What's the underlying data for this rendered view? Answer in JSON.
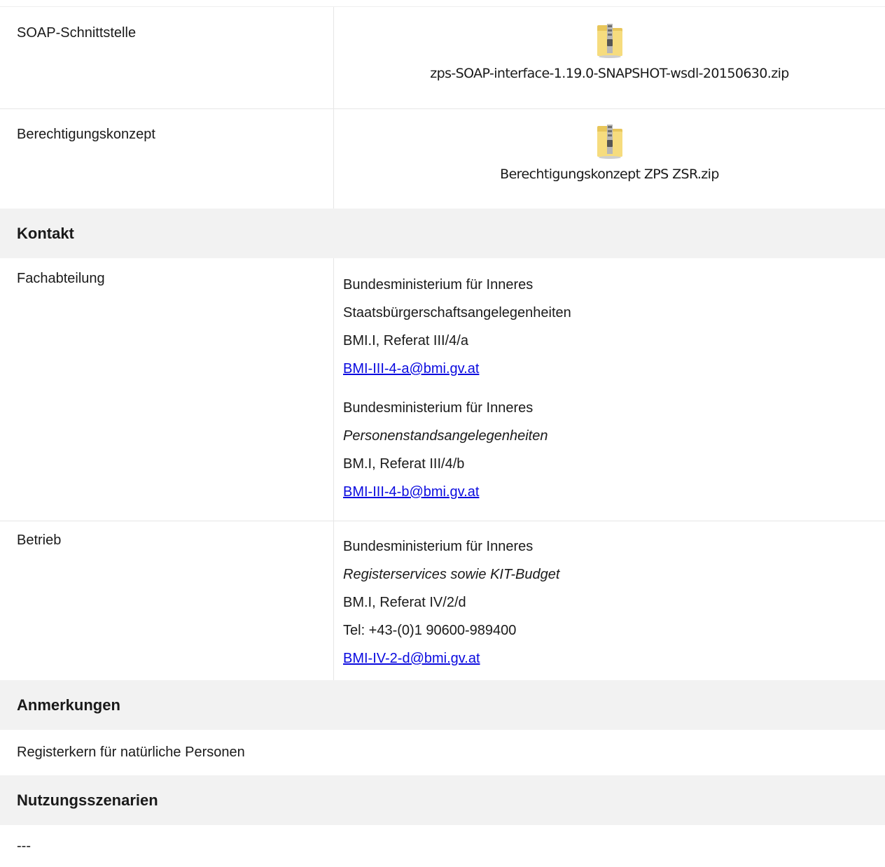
{
  "downloads": [
    {
      "label": "SOAP-Schnittstelle",
      "file": "zps-SOAP-interface-1.19.0-SNAPSHOT-wsdl-20150630.zip",
      "icon": "zip-folder-icon"
    },
    {
      "label": "Berechtigungskonzept",
      "file": "Berechtigungskonzept ZPS ZSR.zip",
      "icon": "zip-folder-icon"
    }
  ],
  "kontakt": {
    "heading": "Kontakt",
    "fachabteilung": {
      "label": "Fachabteilung",
      "block1": {
        "org": "Bundesministerium für Inneres",
        "dept": "Staatsbürgerschaftsangelegenheiten",
        "ref": "BMI.I, Referat III/4/a",
        "email": "BMI-III-4-a@bmi.gv.at"
      },
      "block2": {
        "org": "Bundesministerium für Inneres",
        "dept": "Personenstandsangelegenheiten",
        "ref": "BM.I, Referat III/4/b",
        "email": "BMI-III-4-b@bmi.gv.at"
      }
    },
    "betrieb": {
      "label": "Betrieb",
      "org": "Bundesministerium für Inneres",
      "dept": "Registerservices sowie KIT-Budget",
      "ref": "BM.I, Referat IV/2/d",
      "tel": "Tel: +43-(0)1 90600-989400",
      "email": "BMI-IV-2-d@bmi.gv.at"
    }
  },
  "anmerkungen": {
    "heading": "Anmerkungen",
    "text": "Registerkern für natürliche Personen"
  },
  "nutzung": {
    "heading": "Nutzungsszenarien",
    "text": "---"
  },
  "colors": {
    "link": "#0a0adf",
    "header_bg": "#f2f2f2",
    "border": "#e6e6e6"
  }
}
